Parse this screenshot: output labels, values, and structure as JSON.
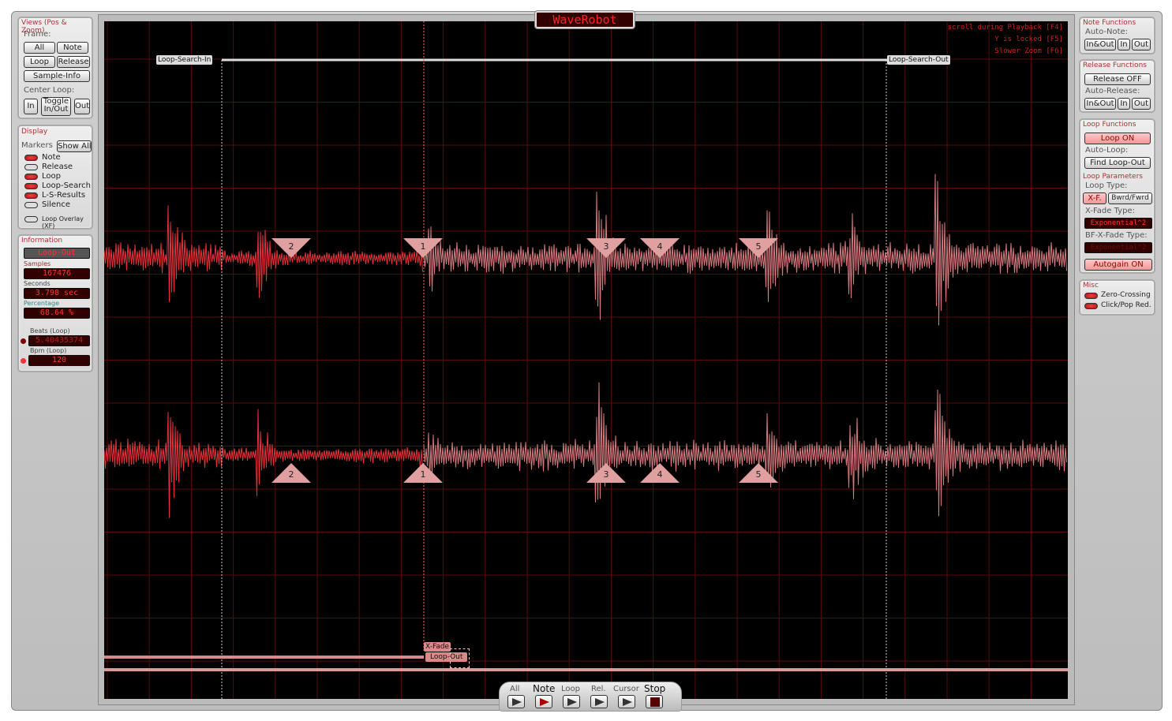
{
  "app_title": "WaveRobot",
  "views": {
    "title": "Views (Pos & Zoom)",
    "frame_label": "Frame:",
    "all": "All",
    "note": "Note",
    "loop": "Loop",
    "release": "Release",
    "sample_info": "Sample-Info",
    "center_loop_label": "Center Loop:",
    "in": "In",
    "toggle": "Toggle In/Out",
    "out": "Out"
  },
  "display": {
    "title": "Display",
    "markers_label": "Markers",
    "show_all": "Show All",
    "markers": [
      {
        "label": "Note",
        "on": true
      },
      {
        "label": "Release",
        "on": false
      },
      {
        "label": "Loop",
        "on": true
      },
      {
        "label": "Loop-Search",
        "on": true
      },
      {
        "label": "L-S-Results",
        "on": true
      },
      {
        "label": "Silence",
        "on": false
      }
    ],
    "loop_overlay": "Loop Overlay (XF)"
  },
  "information": {
    "title": "Information",
    "current": "Loop-Out",
    "samples_label": "Samples",
    "samples": "167476",
    "seconds_label": "Seconds",
    "seconds": "3.798 sec",
    "percentage_label": "Percentage",
    "percentage": "68.64 %",
    "beats_label": "Beats (Loop)",
    "beats": "5.40435374",
    "bpm_label": "Bpm (Loop)",
    "bpm": "120"
  },
  "note_functions": {
    "title": "Note Functions",
    "auto_note": "Auto-Note:",
    "in_out": "In&Out",
    "in": "In",
    "out": "Out"
  },
  "release_functions": {
    "title": "Release Functions",
    "release_toggle": "Release OFF",
    "auto_release": "Auto-Release:",
    "in_out": "In&Out",
    "in": "In",
    "out": "Out"
  },
  "loop_functions": {
    "title": "Loop Functions",
    "loop_toggle": "Loop ON",
    "auto_loop": "Auto-Loop:",
    "find_loop_out": "Find Loop-Out",
    "params_title": "Loop Parameters",
    "loop_type_label": "Loop Type:",
    "xf": "X-F.",
    "bwrd_fwrd": "Bwrd/Fwrd",
    "xfade_type_label": "X-Fade Type:",
    "xfade_type": "Exponential^2",
    "bf_xfade_type_label": "BF-X-Fade Type:",
    "bf_xfade_type": "Exponential^2",
    "autogain": "Autogain ON"
  },
  "misc": {
    "title": "Misc",
    "zero_crossing": "Zero-Crossing",
    "click_pop": "Click/Pop Red."
  },
  "hints": [
    "scroll during Playback [F4]",
    "Y is locked [F5]",
    "Slower Zoom [F6]"
  ],
  "waveform": {
    "loop_search_in": "Loop-Search-In",
    "loop_search_out": "Loop-Search-Out",
    "xfade": "X-Fade",
    "loop_out": "Loop-Out",
    "result_markers": [
      "2",
      "1",
      "3",
      "4",
      "5"
    ]
  },
  "transport": {
    "all": "All",
    "note": "Note",
    "loop": "Loop",
    "rel": "Rel.",
    "cursor": "Cursor",
    "stop": "Stop"
  },
  "colors": {
    "wave": "#e8303a",
    "wave_loop": "#d87a80",
    "grid": "#5a0a0a",
    "marker": "#e0a0a0"
  }
}
